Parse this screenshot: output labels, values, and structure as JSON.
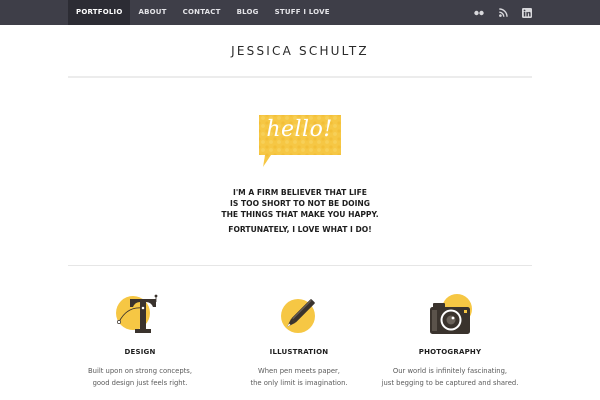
{
  "nav": {
    "items": [
      {
        "label": "PORTFOLIO",
        "active": true
      },
      {
        "label": "ABOUT"
      },
      {
        "label": "CONTACT"
      },
      {
        "label": "BLOG"
      },
      {
        "label": "STUFF I LOVE"
      }
    ]
  },
  "social": {
    "icons": [
      "flickr-icon",
      "rss-icon",
      "linkedin-icon"
    ]
  },
  "site": {
    "title": "JESSICA SCHULTZ"
  },
  "hello": {
    "text": "hello!"
  },
  "intro": {
    "lines": [
      "I'M A FIRM BELIEVER THAT LIFE",
      "IS TOO SHORT TO NOT BE DOING",
      "THE THINGS THAT MAKE YOU HAPPY."
    ],
    "closing": "FORTUNATELY, I LOVE WHAT I DO!"
  },
  "features": [
    {
      "title": "DESIGN",
      "icon": "typography-icon",
      "desc": [
        "Built upon on strong concepts,",
        "good design just feels right."
      ]
    },
    {
      "title": "ILLUSTRATION",
      "icon": "pen-icon",
      "desc": [
        "When pen meets paper,",
        "the only limit is imagination."
      ]
    },
    {
      "title": "PHOTOGRAPHY",
      "icon": "camera-icon",
      "desc": [
        "Our world is infinitely fascinating,",
        "just begging to be captured and shared."
      ]
    }
  ],
  "colors": {
    "topbar": "#3e3e48",
    "active_nav": "#2c2c34",
    "accent": "#f6c744"
  }
}
